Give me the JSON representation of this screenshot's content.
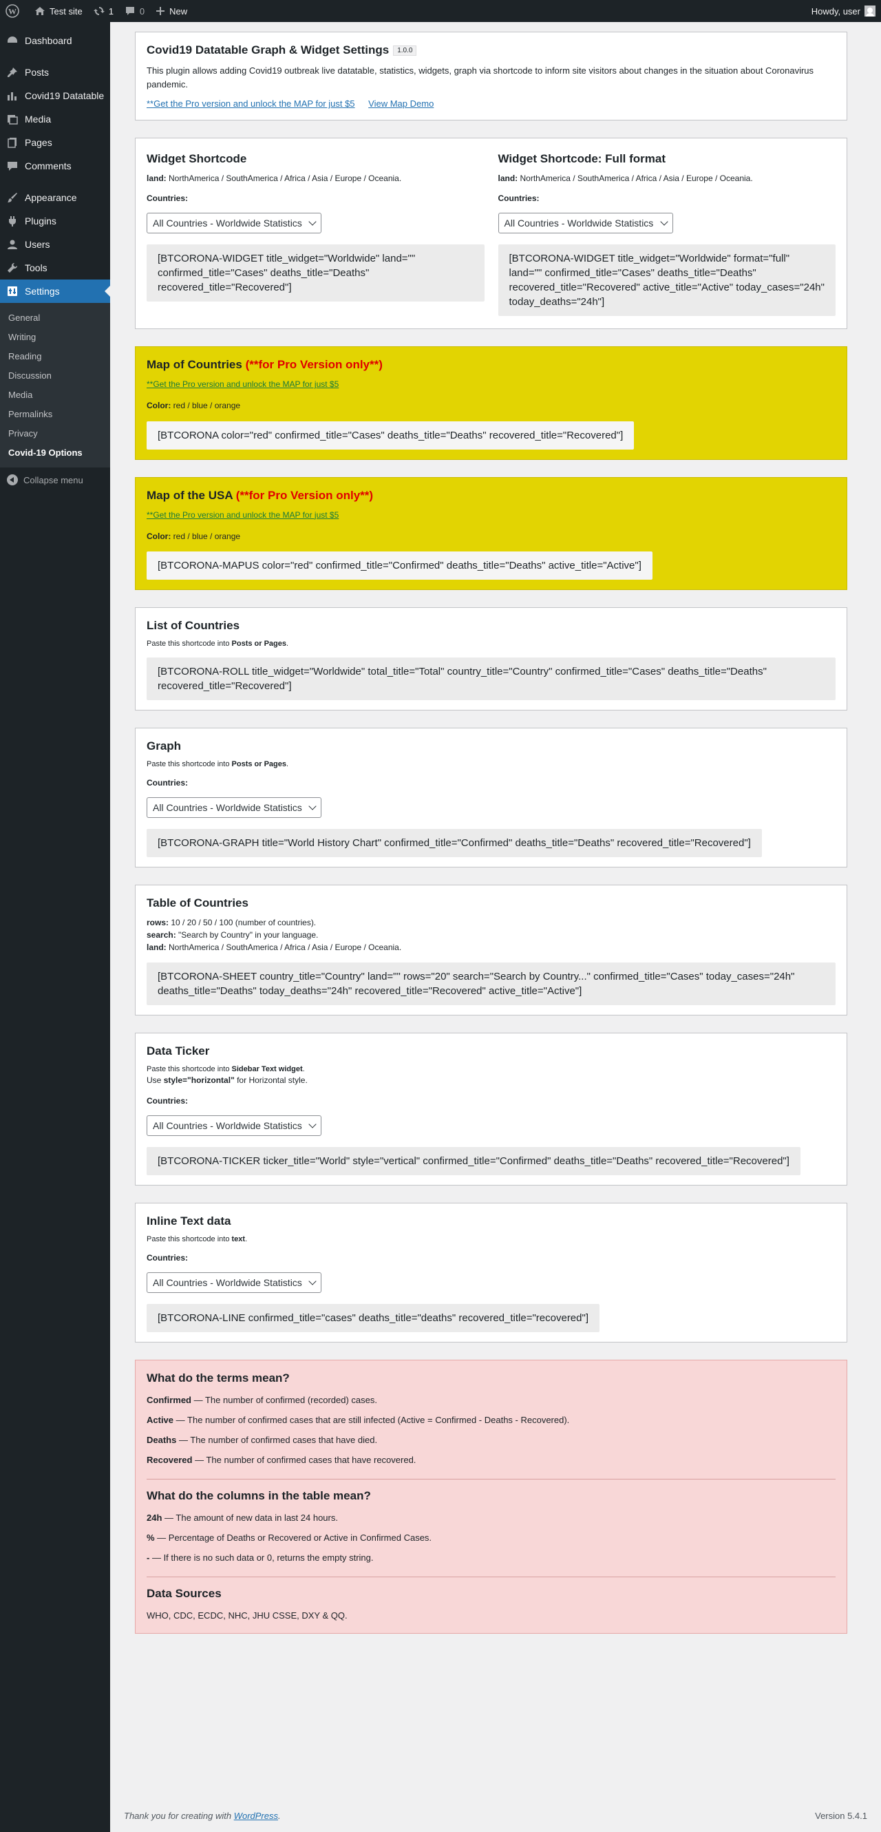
{
  "adminbar": {
    "site_name": "Test site",
    "updates_count": "1",
    "comments_count": "0",
    "new_label": "New",
    "howdy": "Howdy, user"
  },
  "sidebar": {
    "items": [
      {
        "label": "Dashboard",
        "icon": "dashboard-icon"
      },
      {
        "label": "Posts",
        "icon": "pin-icon"
      },
      {
        "label": "Covid19 Datatable",
        "icon": "bar-chart-icon"
      },
      {
        "label": "Media",
        "icon": "media-icon"
      },
      {
        "label": "Pages",
        "icon": "pages-icon"
      },
      {
        "label": "Comments",
        "icon": "comments-icon"
      },
      {
        "label": "Appearance",
        "icon": "brush-icon"
      },
      {
        "label": "Plugins",
        "icon": "plugin-icon"
      },
      {
        "label": "Users",
        "icon": "users-icon"
      },
      {
        "label": "Tools",
        "icon": "wrench-icon"
      },
      {
        "label": "Settings",
        "icon": "settings-icon"
      }
    ],
    "submenu": [
      "General",
      "Writing",
      "Reading",
      "Discussion",
      "Media",
      "Permalinks",
      "Privacy",
      "Covid-19 Options"
    ],
    "collapse": "Collapse menu"
  },
  "header_panel": {
    "title": "Covid19 Datatable Graph & Widget Settings",
    "version": "1.0.0",
    "description": "This plugin allows adding Covid19 outbreak live datatable, statistics, widgets, graph via shortcode to inform site visitors about changes in the situation about Coronavirus pandemic.",
    "pro_link": "**Get the Pro version and unlock the MAP for just $5",
    "demo_link": "View Map Demo"
  },
  "widget": {
    "title_left": "Widget Shortcode",
    "title_right": "Widget Shortcode: Full format",
    "land_label": "land:",
    "land_value": "NorthAmerica / SouthAmerica / Africa / Asia / Europe / Oceania.",
    "countries_label": "Countries:",
    "select_value": "All Countries - Worldwide Statistics",
    "code_left": "[BTCORONA-WIDGET title_widget=\"Worldwide\" land=\"\" confirmed_title=\"Cases\" deaths_title=\"Deaths\" recovered_title=\"Recovered\"]",
    "code_right": "[BTCORONA-WIDGET title_widget=\"Worldwide\" format=\"full\" land=\"\" confirmed_title=\"Cases\" deaths_title=\"Deaths\" recovered_title=\"Recovered\" active_title=\"Active\" today_cases=\"24h\" today_deaths=\"24h\"]"
  },
  "map_countries": {
    "title": "Map of Countries",
    "pro_note": "(**for Pro Version only**)",
    "pro_link": "**Get the Pro version and unlock the MAP for just $5",
    "color_label": "Color:",
    "color_value": "red / blue / orange",
    "code": "[BTCORONA color=\"red\" confirmed_title=\"Cases\" deaths_title=\"Deaths\" recovered_title=\"Recovered\"]"
  },
  "map_usa": {
    "title": "Map of the USA",
    "pro_note": "(**for Pro Version only**)",
    "pro_link": "**Get the Pro version and unlock the MAP for just $5",
    "color_label": "Color:",
    "color_value": "red / blue / orange",
    "code": "[BTCORONA-MAPUS color=\"red\" confirmed_title=\"Confirmed\" deaths_title=\"Deaths\" active_title=\"Active\"]"
  },
  "list_countries": {
    "title": "List of Countries",
    "paste_prefix": "Paste this shortcode into ",
    "paste_target": "Posts or Pages",
    "code": "[BTCORONA-ROLL title_widget=\"Worldwide\" total_title=\"Total\" country_title=\"Country\" confirmed_title=\"Cases\" deaths_title=\"Deaths\" recovered_title=\"Recovered\"]"
  },
  "graph": {
    "title": "Graph",
    "paste_prefix": "Paste this shortcode into ",
    "paste_target": "Posts or Pages",
    "countries_label": "Countries:",
    "select_value": "All Countries - Worldwide Statistics",
    "code": "[BTCORONA-GRAPH title=\"World History Chart\" confirmed_title=\"Confirmed\" deaths_title=\"Deaths\" recovered_title=\"Recovered\"]"
  },
  "table_countries": {
    "title": "Table of Countries",
    "rows_label": "rows:",
    "rows_value": "10 / 20 / 50 / 100 (number of countries).",
    "search_label": "search:",
    "search_value": "\"Search by Country\" in your language.",
    "land_label": "land:",
    "land_value": "NorthAmerica / SouthAmerica / Africa / Asia / Europe / Oceania.",
    "code": "[BTCORONA-SHEET country_title=\"Country\" land=\"\" rows=\"20\" search=\"Search by Country...\" confirmed_title=\"Cases\" today_cases=\"24h\" deaths_title=\"Deaths\" today_deaths=\"24h\" recovered_title=\"Recovered\" active_title=\"Active\"]"
  },
  "ticker": {
    "title": "Data Ticker",
    "paste_prefix": "Paste this shortcode into ",
    "paste_target": "Sidebar Text widget",
    "use_prefix": "Use ",
    "use_style": "style=\"horizontal\"",
    "use_suffix": " for Horizontal style.",
    "countries_label": "Countries:",
    "select_value": "All Countries - Worldwide Statistics",
    "code": "[BTCORONA-TICKER ticker_title=\"World\" style=\"vertical\" confirmed_title=\"Confirmed\" deaths_title=\"Deaths\" recovered_title=\"Recovered\"]"
  },
  "inline": {
    "title": "Inline Text data",
    "paste_prefix": "Paste this shortcode into ",
    "paste_target": "text",
    "countries_label": "Countries:",
    "select_value": "All Countries - Worldwide Statistics",
    "code": "[BTCORONA-LINE confirmed_title=\"cases\" deaths_title=\"deaths\" recovered_title=\"recovered\"]"
  },
  "terms": {
    "title": "What do the terms mean?",
    "items": [
      {
        "term": "Confirmed",
        "text": " — The number of confirmed (recorded) cases."
      },
      {
        "term": "Active",
        "text": " — The number of confirmed cases that are still infected (Active = Confirmed - Deaths - Recovered)."
      },
      {
        "term": "Deaths",
        "text": " — The number of confirmed cases that have died."
      },
      {
        "term": "Recovered",
        "text": " — The number of confirmed cases that have recovered."
      }
    ],
    "columns_title": "What do the columns in the table mean?",
    "columns": [
      {
        "term": "24h",
        "text": " — The amount of new data in last 24 hours."
      },
      {
        "term": "%",
        "text": " — Percentage of Deaths or Recovered or Active in Confirmed Cases."
      },
      {
        "term": "-",
        "text": " — If there is no such data or 0, returns the empty string."
      }
    ],
    "sources_title": "Data Sources",
    "sources": "WHO, CDC, ECDC, NHC, JHU CSSE, DXY & QQ."
  },
  "footer": {
    "thanks_prefix": "Thank you for creating with ",
    "wordpress": "WordPress",
    "thanks_suffix": ".",
    "version": "Version 5.4.1"
  }
}
